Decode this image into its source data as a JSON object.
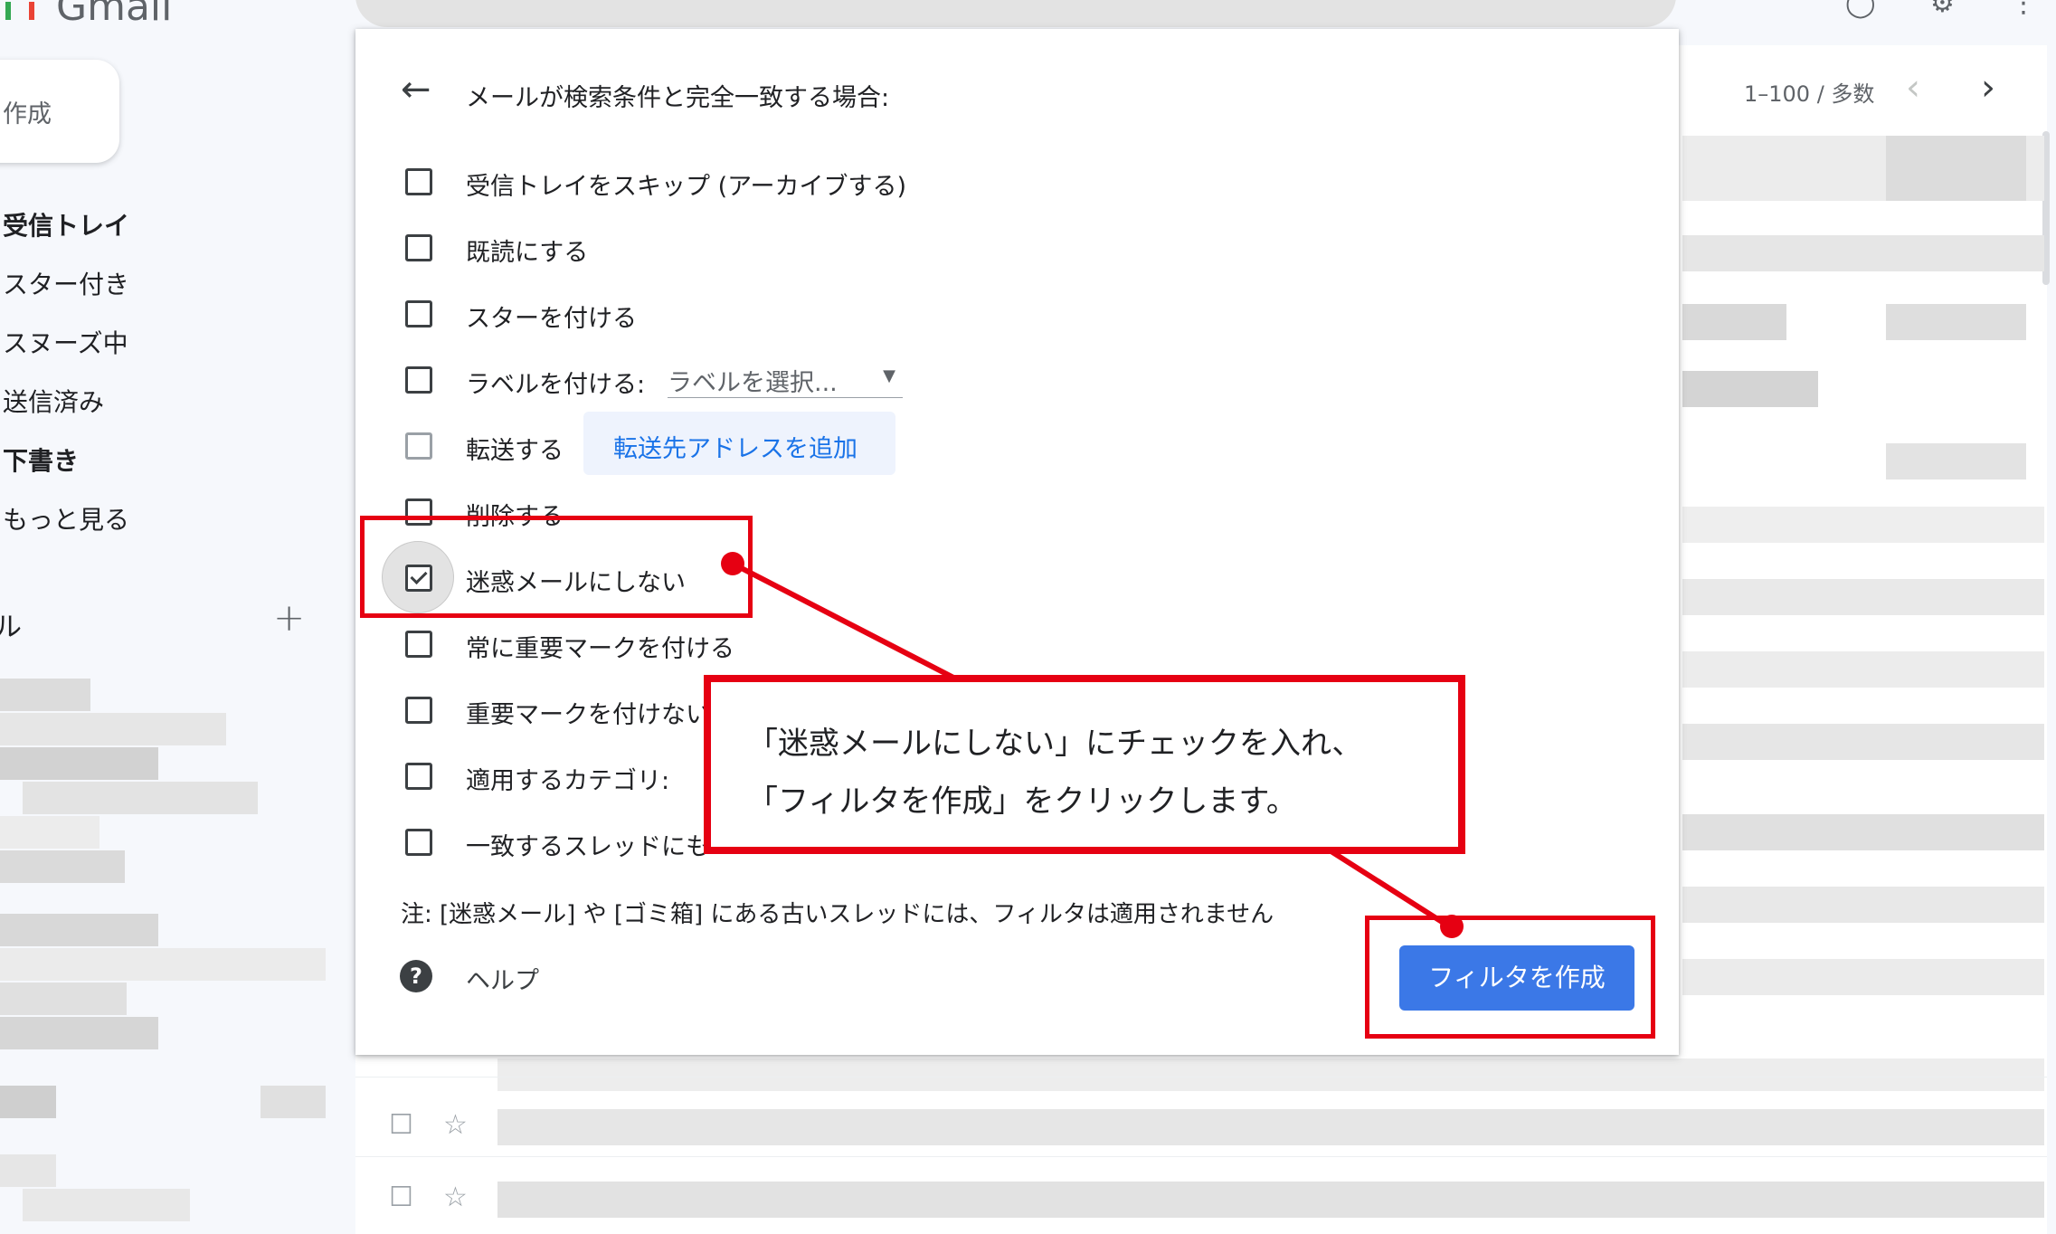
{
  "app": {
    "logo_text": "Gmail"
  },
  "nav": {
    "compose_label": "作成",
    "items": [
      {
        "label": "受信トレイ",
        "bold": true
      },
      {
        "label": "スター付き",
        "bold": false
      },
      {
        "label": "スヌーズ中",
        "bold": false
      },
      {
        "label": "送信済み",
        "bold": false
      },
      {
        "label": "下書き",
        "bold": true
      },
      {
        "label": "もっと見る",
        "bold": false
      }
    ],
    "labels_heading": "ル",
    "labels_add": "+"
  },
  "list": {
    "pagination": "1–100 / 多数"
  },
  "dialog": {
    "title": "メールが検索条件と完全一致する場合:",
    "options": [
      {
        "label": "受信トレイをスキップ (アーカイブする)",
        "checked": false
      },
      {
        "label": "既読にする",
        "checked": false
      },
      {
        "label": "スターを付ける",
        "checked": false
      },
      {
        "label": "ラベルを付ける:",
        "checked": false
      },
      {
        "label": "転送する",
        "checked": false,
        "disabled": true
      },
      {
        "label": "削除する",
        "checked": false
      },
      {
        "label": "迷惑メールにしない",
        "checked": true
      },
      {
        "label": "常に重要マークを付ける",
        "checked": false
      },
      {
        "label": "重要マークを付けない",
        "checked": false
      },
      {
        "label": "適用するカテゴリ:",
        "checked": false
      },
      {
        "label": "一致するスレッドにも",
        "checked": false
      }
    ],
    "label_select_placeholder": "ラベルを選択...",
    "forward_add_label": "転送先アドレスを追加",
    "note": "注: [迷惑メール] や [ゴミ箱] にある古いスレッドには、フィルタは適用されません",
    "help_icon": "?",
    "help_label": "ヘルプ",
    "create_button": "フィルタを作成"
  },
  "annotation": {
    "line1": "「迷惑メールにしない」にチェックを入れ、",
    "line2": "「フィルタを作成」をクリックします。",
    "color": "#e60012"
  },
  "icons": {
    "back": "arrow-left-icon",
    "prev": "chevron-left-icon",
    "next": "chevron-right-icon",
    "star": "star-outline-icon",
    "help": "help-circle-icon"
  }
}
